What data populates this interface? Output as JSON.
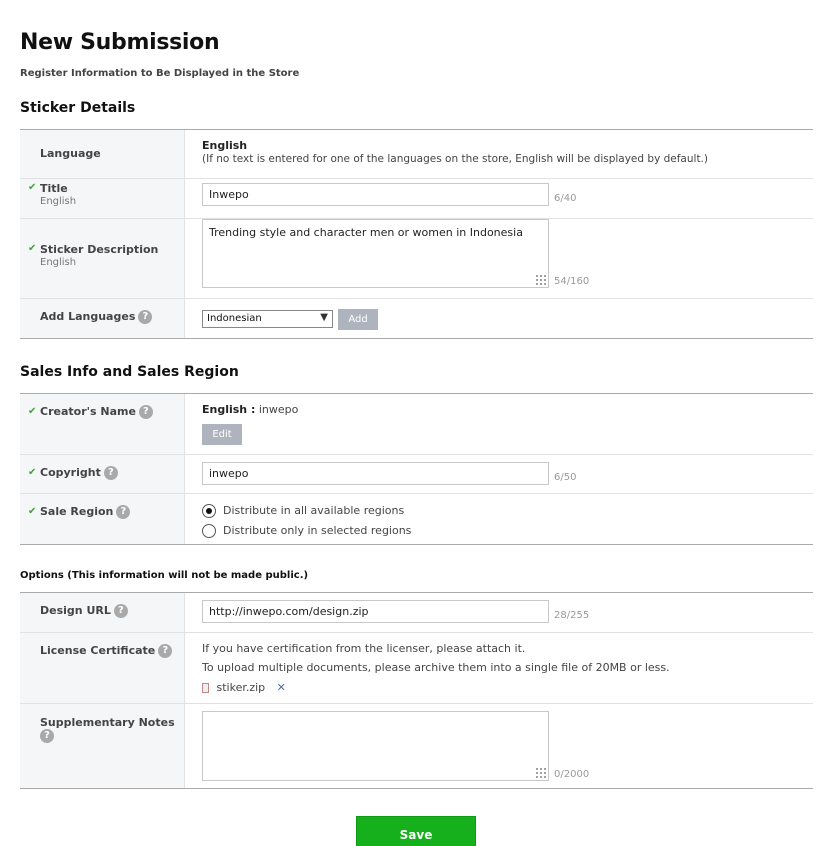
{
  "page": {
    "title": "New Submission",
    "subtitle": "Register Information to Be Displayed in the Store"
  },
  "sticker_details": {
    "heading": "Sticker Details",
    "language": {
      "label": "Language",
      "value": "English",
      "note": "(If no text is entered for one of the languages on the store, English will be displayed by default.)"
    },
    "title": {
      "label": "Title",
      "sub": "English",
      "value": "Inwepo",
      "counter": "6/40"
    },
    "description": {
      "label": "Sticker Description",
      "sub": "English",
      "value": "Trending style and character men or women in Indonesia",
      "counter": "54/160"
    },
    "add_languages": {
      "label": "Add Languages",
      "selected": "Indonesian",
      "button": "Add"
    }
  },
  "sales": {
    "heading": "Sales Info and Sales Region",
    "creator": {
      "label": "Creator's Name",
      "lang": "English :",
      "value": "inwepo",
      "button": "Edit"
    },
    "copyright": {
      "label": "Copyright",
      "value": "inwepo",
      "counter": "6/50"
    },
    "region": {
      "label": "Sale Region",
      "options": [
        "Distribute in all available regions",
        "Distribute only in selected regions"
      ],
      "selected_index": 0
    }
  },
  "options": {
    "heading": "Options (This information will not be made public.)",
    "design_url": {
      "label": "Design URL",
      "value": "http://inwepo.com/design.zip",
      "counter": "28/255"
    },
    "license": {
      "label": "License Certificate",
      "line1": "If you have certification from the licenser, please attach it.",
      "line2": "To upload multiple documents, please archive them into a single file of 20MB or less.",
      "file": "stiker.zip",
      "remove": "✕"
    },
    "notes": {
      "label": "Supplementary Notes",
      "value": "",
      "counter": "0/2000"
    }
  },
  "help_glyph": "?",
  "check_glyph": "✔",
  "save_label": "Save",
  "colors": {
    "accent_green": "#16b01d",
    "check_green": "#3fa535",
    "button_gray": "#aeb4bd",
    "label_bg": "#f5f6f8"
  }
}
